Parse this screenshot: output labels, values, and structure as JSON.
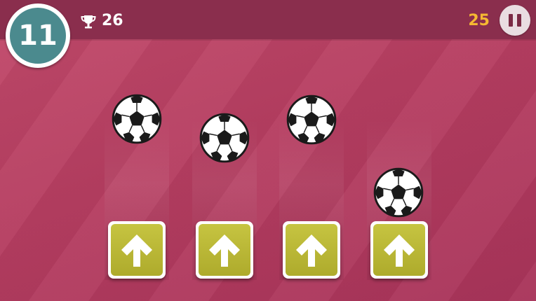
{
  "level": "11",
  "best_score": "26",
  "current_score": "25",
  "colors": {
    "background": "#b63e61",
    "topbar": "#8a2e4d",
    "level_badge": "#4b8a8e",
    "current_score": "#f5b932",
    "arrow_button": "#b9b737"
  },
  "icons": {
    "trophy": "trophy-icon",
    "pause": "pause-icon",
    "ball": "soccer-ball-icon",
    "arrow": "arrow-up-icon"
  },
  "lanes": [
    {
      "ball": "soccer-ball",
      "button": "arrow-up"
    },
    {
      "ball": "soccer-ball",
      "button": "arrow-up"
    },
    {
      "ball": "soccer-ball",
      "button": "arrow-up"
    },
    {
      "ball": "soccer-ball",
      "button": "arrow-up"
    }
  ]
}
